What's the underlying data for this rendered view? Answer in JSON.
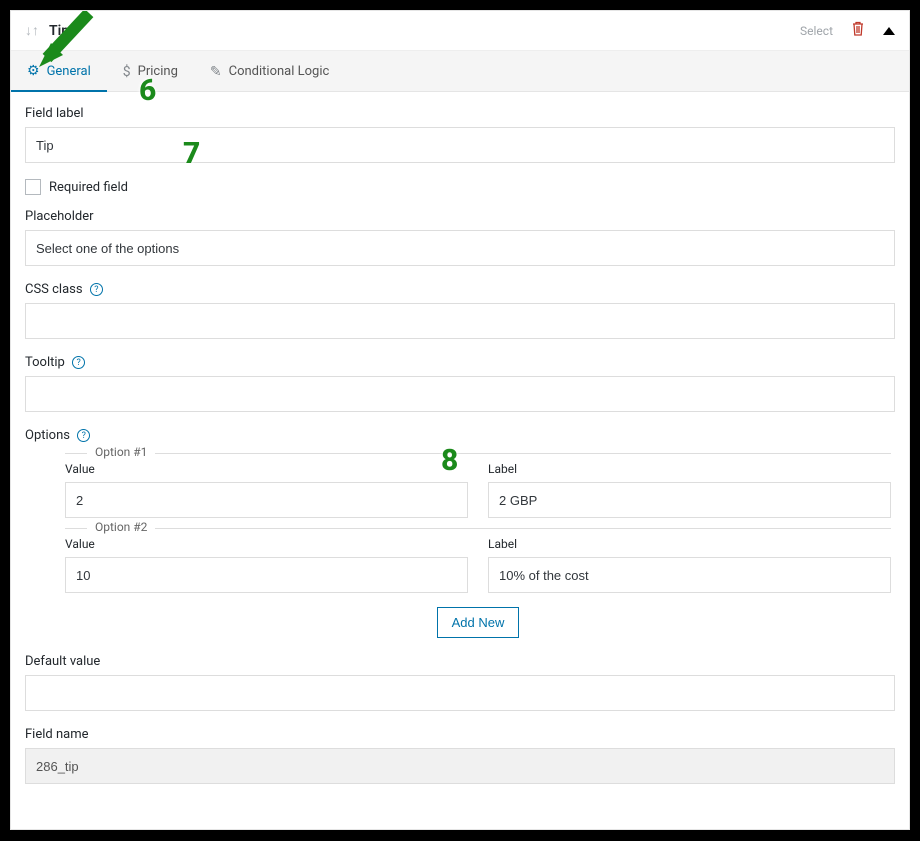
{
  "header": {
    "title": "Tip",
    "select_label": "Select"
  },
  "tabs": {
    "general": "General",
    "pricing": "Pricing",
    "conditional": "Conditional Logic"
  },
  "labels": {
    "field_label": "Field label",
    "required_field": "Required field",
    "placeholder": "Placeholder",
    "css_class": "CSS class",
    "tooltip": "Tooltip",
    "options": "Options",
    "value": "Value",
    "label": "Label",
    "default_value": "Default value",
    "field_name": "Field name",
    "option1": "Option #1",
    "option2": "Option #2",
    "add_new": "Add New"
  },
  "values": {
    "field_label": "Tip",
    "placeholder": "Select one of the options",
    "css_class": "",
    "tooltip": "",
    "default_value": "",
    "field_name": "286_tip",
    "options": [
      {
        "value": "2",
        "label": "2 GBP"
      },
      {
        "value": "10",
        "label": "10% of the cost"
      }
    ]
  },
  "annotations": {
    "n6": "6",
    "n7": "7",
    "n8": "8"
  }
}
